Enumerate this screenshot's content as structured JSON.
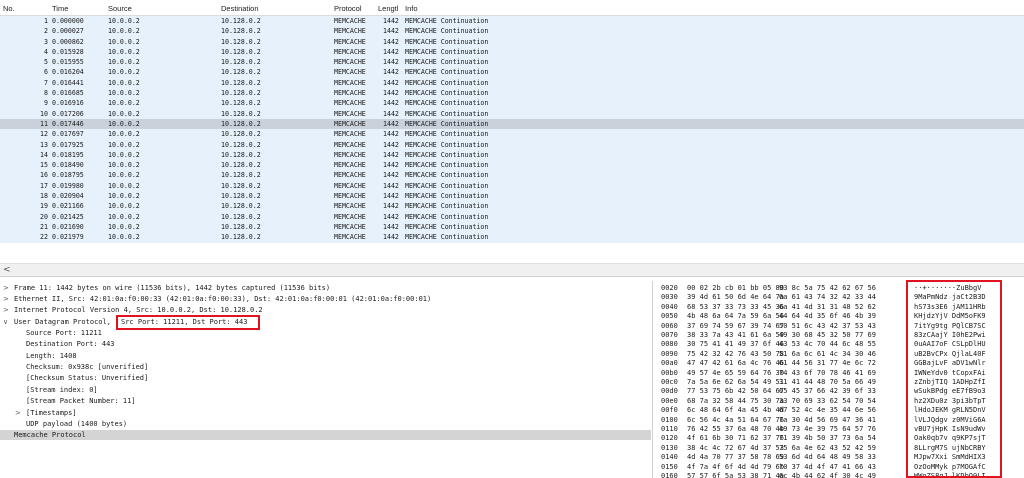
{
  "packet_list": {
    "columns": {
      "no": "No.",
      "time": "Time",
      "source": "Source",
      "destination": "Destination",
      "protocol": "Protocol",
      "length": "Lengtl",
      "info": "Info"
    },
    "rows": [
      {
        "no": "1",
        "time": "0.000000",
        "src": "10.0.0.2",
        "dst": "10.128.0.2",
        "proto": "MEMCACHE",
        "len": "1442",
        "info": "MEMCACHE Continuation"
      },
      {
        "no": "2",
        "time": "0.000027",
        "src": "10.0.0.2",
        "dst": "10.128.0.2",
        "proto": "MEMCACHE",
        "len": "1442",
        "info": "MEMCACHE Continuation"
      },
      {
        "no": "3",
        "time": "0.000862",
        "src": "10.0.0.2",
        "dst": "10.128.0.2",
        "proto": "MEMCACHE",
        "len": "1442",
        "info": "MEMCACHE Continuation"
      },
      {
        "no": "4",
        "time": "0.015928",
        "src": "10.0.0.2",
        "dst": "10.128.0.2",
        "proto": "MEMCACHE",
        "len": "1442",
        "info": "MEMCACHE Continuation"
      },
      {
        "no": "5",
        "time": "0.015955",
        "src": "10.0.0.2",
        "dst": "10.128.0.2",
        "proto": "MEMCACHE",
        "len": "1442",
        "info": "MEMCACHE Continuation"
      },
      {
        "no": "6",
        "time": "0.016204",
        "src": "10.0.0.2",
        "dst": "10.128.0.2",
        "proto": "MEMCACHE",
        "len": "1442",
        "info": "MEMCACHE Continuation"
      },
      {
        "no": "7",
        "time": "0.016441",
        "src": "10.0.0.2",
        "dst": "10.128.0.2",
        "proto": "MEMCACHE",
        "len": "1442",
        "info": "MEMCACHE Continuation"
      },
      {
        "no": "8",
        "time": "0.016685",
        "src": "10.0.0.2",
        "dst": "10.128.0.2",
        "proto": "MEMCACHE",
        "len": "1442",
        "info": "MEMCACHE Continuation"
      },
      {
        "no": "9",
        "time": "0.016916",
        "src": "10.0.0.2",
        "dst": "10.128.0.2",
        "proto": "MEMCACHE",
        "len": "1442",
        "info": "MEMCACHE Continuation"
      },
      {
        "no": "10",
        "time": "0.017206",
        "src": "10.0.0.2",
        "dst": "10.128.0.2",
        "proto": "MEMCACHE",
        "len": "1442",
        "info": "MEMCACHE Continuation"
      },
      {
        "no": "11",
        "time": "0.017446",
        "src": "10.0.0.2",
        "dst": "10.128.0.2",
        "proto": "MEMCACHE",
        "len": "1442",
        "info": "MEMCACHE Continuation",
        "selected": true
      },
      {
        "no": "12",
        "time": "0.017697",
        "src": "10.0.0.2",
        "dst": "10.128.0.2",
        "proto": "MEMCACHE",
        "len": "1442",
        "info": "MEMCACHE Continuation"
      },
      {
        "no": "13",
        "time": "0.017925",
        "src": "10.0.0.2",
        "dst": "10.128.0.2",
        "proto": "MEMCACHE",
        "len": "1442",
        "info": "MEMCACHE Continuation"
      },
      {
        "no": "14",
        "time": "0.018195",
        "src": "10.0.0.2",
        "dst": "10.128.0.2",
        "proto": "MEMCACHE",
        "len": "1442",
        "info": "MEMCACHE Continuation"
      },
      {
        "no": "15",
        "time": "0.018490",
        "src": "10.0.0.2",
        "dst": "10.128.0.2",
        "proto": "MEMCACHE",
        "len": "1442",
        "info": "MEMCACHE Continuation"
      },
      {
        "no": "16",
        "time": "0.018795",
        "src": "10.0.0.2",
        "dst": "10.128.0.2",
        "proto": "MEMCACHE",
        "len": "1442",
        "info": "MEMCACHE Continuation"
      },
      {
        "no": "17",
        "time": "0.019980",
        "src": "10.0.0.2",
        "dst": "10.128.0.2",
        "proto": "MEMCACHE",
        "len": "1442",
        "info": "MEMCACHE Continuation"
      },
      {
        "no": "18",
        "time": "0.020904",
        "src": "10.0.0.2",
        "dst": "10.128.0.2",
        "proto": "MEMCACHE",
        "len": "1442",
        "info": "MEMCACHE Continuation"
      },
      {
        "no": "19",
        "time": "0.021166",
        "src": "10.0.0.2",
        "dst": "10.128.0.2",
        "proto": "MEMCACHE",
        "len": "1442",
        "info": "MEMCACHE Continuation"
      },
      {
        "no": "20",
        "time": "0.021425",
        "src": "10.0.0.2",
        "dst": "10.128.0.2",
        "proto": "MEMCACHE",
        "len": "1442",
        "info": "MEMCACHE Continuation"
      },
      {
        "no": "21",
        "time": "0.021690",
        "src": "10.0.0.2",
        "dst": "10.128.0.2",
        "proto": "MEMCACHE",
        "len": "1442",
        "info": "MEMCACHE Continuation"
      },
      {
        "no": "22",
        "time": "0.021979",
        "src": "10.0.0.2",
        "dst": "10.128.0.2",
        "proto": "MEMCACHE",
        "len": "1442",
        "info": "MEMCACHE Continuation"
      }
    ]
  },
  "scroll": {
    "left_arrow": "<"
  },
  "details": {
    "collapsed_glyph": ">",
    "expanded_glyph": "∨",
    "frame": "Frame 11: 1442 bytes on wire (11536 bits), 1442 bytes captured (11536 bits)",
    "ethernet": "Ethernet II, Src: 42:01:0a:f0:00:33 (42:01:0a:f0:00:33), Dst: 42:01:0a:f0:00:01 (42:01:0a:f0:00:01)",
    "ip": "Internet Protocol Version 4, Src: 10.0.0.2, Dst: 10.128.0.2",
    "udp_prefix": "User Datagram Protocol, ",
    "udp_ports": "Src Port: 11211, Dst Port: 443",
    "udp_children": [
      "Source Port: 11211",
      "Destination Port: 443",
      "Length: 1408",
      "Checksum: 0x938c [unverified]",
      "[Checksum Status: Unverified]",
      "[Stream index: 0]",
      "[Stream Packet Number: 11]"
    ],
    "timestamps": "[Timestamps]",
    "payload": "UDP payload (1400 bytes)",
    "memcache": "Memcache Protocol"
  },
  "bytes": [
    {
      "off": "0020",
      "h1": "00 02 2b cb 01 bb 05 80",
      "h2": "93 8c 5a 75 42 62 67 56",
      "asc": "··+·······ZuBbgV"
    },
    {
      "off": "0030",
      "h1": "39 4d 61 50 6d 4e 64 7a",
      "h2": "6a 61 43 74 32 42 33 44",
      "asc": "9MaPmNdz jaCt2B3D"
    },
    {
      "off": "0040",
      "h1": "68 53 37 33 73 33 45 36",
      "h2": "6a 41 4d 31 31 48 52 62",
      "asc": "hS73s3E6 jAM11HRb"
    },
    {
      "off": "0050",
      "h1": "4b 48 6a 64 7a 59 6a 56",
      "h2": "44 64 4d 35 6f 46 4b 39",
      "asc": "KHjdzYjV DdM5oFK9"
    },
    {
      "off": "0060",
      "h1": "37 69 74 59 67 39 74 67",
      "h2": "50 51 6c 43 42 37 53 43",
      "asc": "7itYg9tg PQlCB7SC"
    },
    {
      "off": "0070",
      "h1": "38 33 7a 43 41 61 6a 59",
      "h2": "49 30 68 45 32 50 77 69",
      "asc": "83zCAajY I0hE2Pwi"
    },
    {
      "off": "0080",
      "h1": "30 75 41 41 49 37 6f 46",
      "h2": "43 53 4c 70 44 6c 48 55",
      "asc": "0uAAI7oF CSLpDlHU"
    },
    {
      "off": "0090",
      "h1": "75 42 32 42 76 43 50 78",
      "h2": "51 6a 6c 61 4c 34 30 46",
      "asc": "uB2BvCPx QjlaL40F"
    },
    {
      "off": "00a0",
      "h1": "47 47 42 61 6a 4c 76 46",
      "h2": "61 44 56 31 77 4e 6c 72",
      "asc": "GGBajLvF aDV1wNlr"
    },
    {
      "off": "00b0",
      "h1": "49 57 4e 65 59 64 76 30",
      "h2": "74 43 6f 70 78 46 41 69",
      "asc": "IWNeYdv0 tCopxFAi"
    },
    {
      "off": "00c0",
      "h1": "7a 5a 6e 62 6a 54 49 51",
      "h2": "31 41 44 48 70 5a 66 49",
      "asc": "zZnbjTIQ 1ADHpZfI"
    },
    {
      "off": "00d0",
      "h1": "77 53 75 6b 42 50 64 67",
      "h2": "65 45 37 66 42 39 6f 33",
      "asc": "wSukBPdg eE7fB9o3"
    },
    {
      "off": "00e0",
      "h1": "68 7a 32 58 44 75 30 7a",
      "h2": "33 70 69 33 62 54 70 54",
      "asc": "hz2XDu0z 3pi3bTpT"
    },
    {
      "off": "00f0",
      "h1": "6c 48 64 6f 4a 45 4b 4d",
      "h2": "67 52 4c 4e 35 44 6e 56",
      "asc": "lHdoJEKM gRLN5DnV"
    },
    {
      "off": "0100",
      "h1": "6c 56 4c 4a 51 64 67 76",
      "h2": "7a 30 4d 56 69 47 36 41",
      "asc": "lVLJQdgv z0MViG6A"
    },
    {
      "off": "0110",
      "h1": "76 42 55 37 6a 48 70 4b",
      "h2": "49 73 4e 39 75 64 57 76",
      "asc": "vBU7jHpK IsN9udWv"
    },
    {
      "off": "0120",
      "h1": "4f 61 6b 30 71 62 37 76",
      "h2": "71 39 4b 50 37 73 6a 54",
      "asc": "Oak0qb7v q9KP7sjT"
    },
    {
      "off": "0130",
      "h1": "38 4c 4c 72 67 4d 37 53",
      "h2": "75 6a 4e 62 43 52 42 59",
      "asc": "8LLrgM7S ujNbCRBY"
    },
    {
      "off": "0140",
      "h1": "4d 4a 70 77 37 58 78 69",
      "h2": "53 6d 4d 64 48 49 58 33",
      "asc": "MJpw7Xxi SmMdHIX3"
    },
    {
      "off": "0150",
      "h1": "4f 7a 4f 6f 4d 4d 79 6b",
      "h2": "70 37 4d 4f 47 41 66 43",
      "asc": "OzOoMMyk p7MOGAfC"
    },
    {
      "off": "0160",
      "h1": "57 57 6f 5a 53 38 71 4a",
      "h2": "6c 4b 44 62 4f 30 4c 49",
      "asc": "WWoZS8qJ lKDbO0LI"
    }
  ]
}
